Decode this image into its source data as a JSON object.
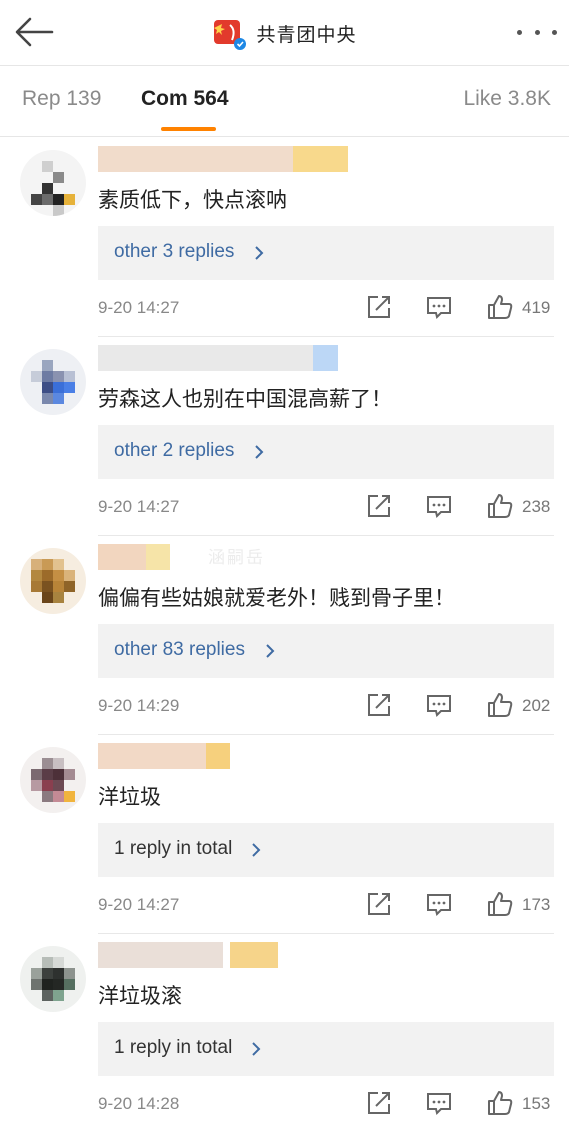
{
  "header": {
    "title": "共青团中央",
    "icons": {
      "back": "arrow-left-icon",
      "more": "more-dots-icon",
      "verified": "verified-badge-icon"
    }
  },
  "tabs": {
    "reposts": "Rep 139",
    "comments": "Com 564",
    "likes": "Like 3.8K"
  },
  "colors": {
    "accent": "#ff8200",
    "link": "#3f6ba3",
    "reply_box": "#f2f2f2"
  },
  "watermark": "涵嗣岳",
  "comments": [
    {
      "text": "素质低下，快点滚呐",
      "replies": "other 3 replies",
      "time": "9-20 14:27",
      "likes": "419"
    },
    {
      "text": "劳森这人也别在中国混高薪了！",
      "replies": "other 2 replies",
      "time": "9-20 14:27",
      "likes": "238"
    },
    {
      "text": "偏偏有些姑娘就爱老外！贱到骨子里！",
      "replies": "other 83 replies",
      "time": "9-20 14:29",
      "likes": "202"
    },
    {
      "text": "洋垃圾",
      "replies": "1 reply in total",
      "time": "9-20 14:27",
      "likes": "173"
    },
    {
      "text": "洋垃圾滚",
      "replies": "1 reply in total",
      "time": "9-20 14:28",
      "likes": "153"
    }
  ]
}
